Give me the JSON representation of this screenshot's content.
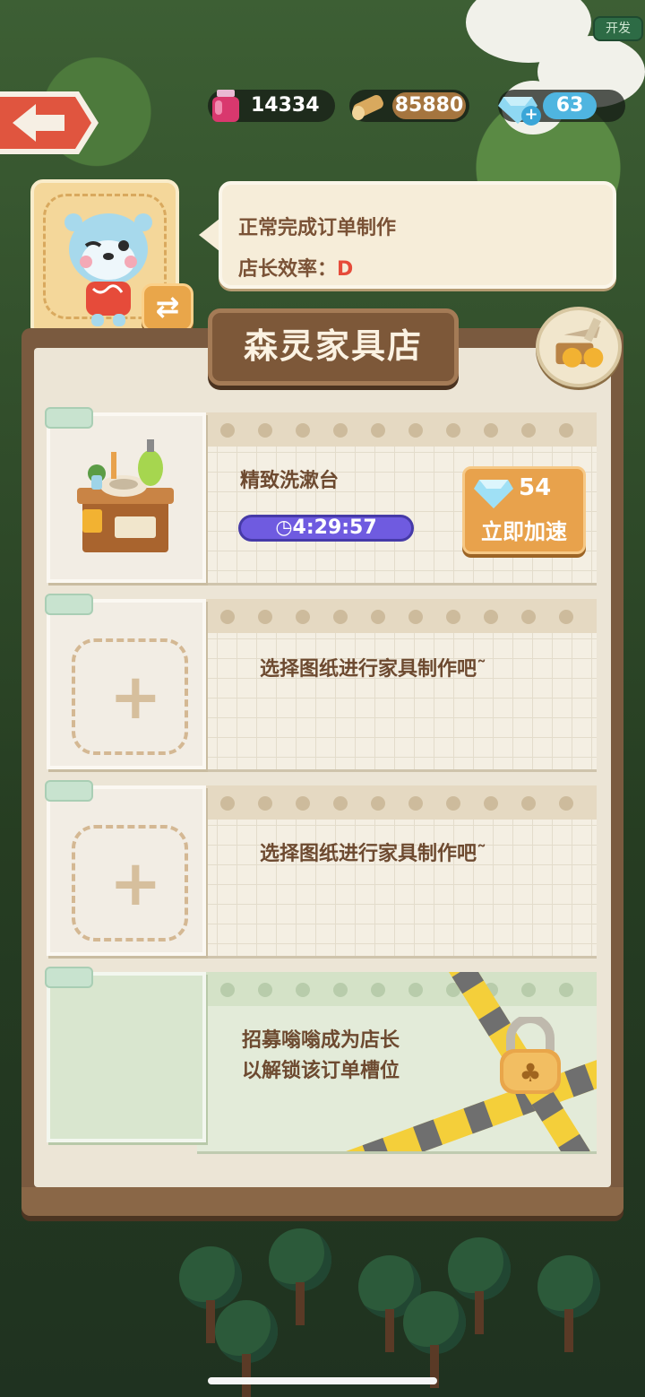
{
  "header": {
    "dev_tag": "开发",
    "resources": [
      {
        "icon": "potion-jar-icon",
        "value": "14334"
      },
      {
        "icon": "wood-log-icon",
        "value": "85880"
      },
      {
        "icon": "diamond-icon",
        "value": "63"
      }
    ]
  },
  "manager": {
    "status_line": "正常完成订单制作",
    "efficiency_label": "店长效率：",
    "efficiency_grade": "D"
  },
  "shop": {
    "title": "森灵家具店"
  },
  "slots": [
    {
      "state": "crafting",
      "item_name": "精致洗漱台",
      "timer": "4:29:57",
      "speed_up": {
        "cost": "54",
        "label": "立即加速"
      }
    },
    {
      "state": "empty",
      "prompt": "选择图纸进行家具制作吧˜"
    },
    {
      "state": "empty",
      "prompt": "选择图纸进行家具制作吧˜"
    },
    {
      "state": "locked",
      "line1": "招募嗡嗡成为店长",
      "line2": "以解锁该订单槽位"
    }
  ],
  "colors": {
    "panel_wood": "#7a5a3f",
    "paper": "#f4efe3",
    "accent_orange": "#e8a24c",
    "timer_purple": "#6f5be0",
    "grade_red": "#e64b3a"
  }
}
